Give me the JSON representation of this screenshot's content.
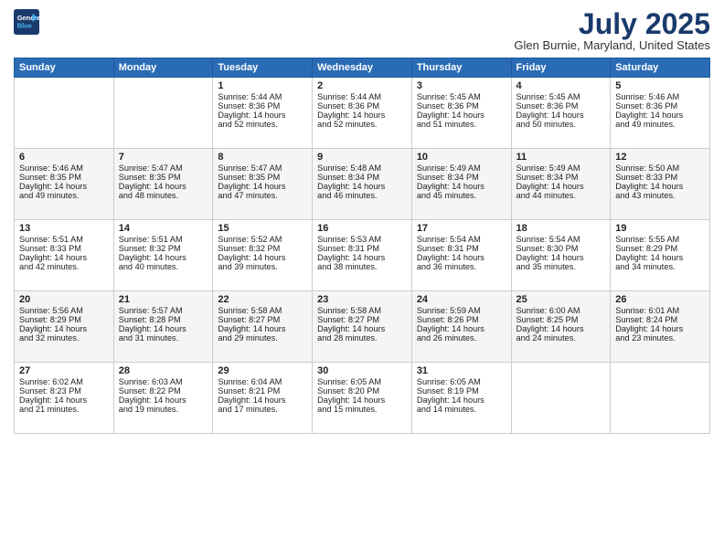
{
  "logo": {
    "line1": "General",
    "line2": "Blue"
  },
  "title": "July 2025",
  "location": "Glen Burnie, Maryland, United States",
  "days_of_week": [
    "Sunday",
    "Monday",
    "Tuesday",
    "Wednesday",
    "Thursday",
    "Friday",
    "Saturday"
  ],
  "weeks": [
    [
      {
        "day": "",
        "text": ""
      },
      {
        "day": "",
        "text": ""
      },
      {
        "day": "1",
        "text": "Sunrise: 5:44 AM\nSunset: 8:36 PM\nDaylight: 14 hours\nand 52 minutes."
      },
      {
        "day": "2",
        "text": "Sunrise: 5:44 AM\nSunset: 8:36 PM\nDaylight: 14 hours\nand 52 minutes."
      },
      {
        "day": "3",
        "text": "Sunrise: 5:45 AM\nSunset: 8:36 PM\nDaylight: 14 hours\nand 51 minutes."
      },
      {
        "day": "4",
        "text": "Sunrise: 5:45 AM\nSunset: 8:36 PM\nDaylight: 14 hours\nand 50 minutes."
      },
      {
        "day": "5",
        "text": "Sunrise: 5:46 AM\nSunset: 8:36 PM\nDaylight: 14 hours\nand 49 minutes."
      }
    ],
    [
      {
        "day": "6",
        "text": "Sunrise: 5:46 AM\nSunset: 8:35 PM\nDaylight: 14 hours\nand 49 minutes."
      },
      {
        "day": "7",
        "text": "Sunrise: 5:47 AM\nSunset: 8:35 PM\nDaylight: 14 hours\nand 48 minutes."
      },
      {
        "day": "8",
        "text": "Sunrise: 5:47 AM\nSunset: 8:35 PM\nDaylight: 14 hours\nand 47 minutes."
      },
      {
        "day": "9",
        "text": "Sunrise: 5:48 AM\nSunset: 8:34 PM\nDaylight: 14 hours\nand 46 minutes."
      },
      {
        "day": "10",
        "text": "Sunrise: 5:49 AM\nSunset: 8:34 PM\nDaylight: 14 hours\nand 45 minutes."
      },
      {
        "day": "11",
        "text": "Sunrise: 5:49 AM\nSunset: 8:34 PM\nDaylight: 14 hours\nand 44 minutes."
      },
      {
        "day": "12",
        "text": "Sunrise: 5:50 AM\nSunset: 8:33 PM\nDaylight: 14 hours\nand 43 minutes."
      }
    ],
    [
      {
        "day": "13",
        "text": "Sunrise: 5:51 AM\nSunset: 8:33 PM\nDaylight: 14 hours\nand 42 minutes."
      },
      {
        "day": "14",
        "text": "Sunrise: 5:51 AM\nSunset: 8:32 PM\nDaylight: 14 hours\nand 40 minutes."
      },
      {
        "day": "15",
        "text": "Sunrise: 5:52 AM\nSunset: 8:32 PM\nDaylight: 14 hours\nand 39 minutes."
      },
      {
        "day": "16",
        "text": "Sunrise: 5:53 AM\nSunset: 8:31 PM\nDaylight: 14 hours\nand 38 minutes."
      },
      {
        "day": "17",
        "text": "Sunrise: 5:54 AM\nSunset: 8:31 PM\nDaylight: 14 hours\nand 36 minutes."
      },
      {
        "day": "18",
        "text": "Sunrise: 5:54 AM\nSunset: 8:30 PM\nDaylight: 14 hours\nand 35 minutes."
      },
      {
        "day": "19",
        "text": "Sunrise: 5:55 AM\nSunset: 8:29 PM\nDaylight: 14 hours\nand 34 minutes."
      }
    ],
    [
      {
        "day": "20",
        "text": "Sunrise: 5:56 AM\nSunset: 8:29 PM\nDaylight: 14 hours\nand 32 minutes."
      },
      {
        "day": "21",
        "text": "Sunrise: 5:57 AM\nSunset: 8:28 PM\nDaylight: 14 hours\nand 31 minutes."
      },
      {
        "day": "22",
        "text": "Sunrise: 5:58 AM\nSunset: 8:27 PM\nDaylight: 14 hours\nand 29 minutes."
      },
      {
        "day": "23",
        "text": "Sunrise: 5:58 AM\nSunset: 8:27 PM\nDaylight: 14 hours\nand 28 minutes."
      },
      {
        "day": "24",
        "text": "Sunrise: 5:59 AM\nSunset: 8:26 PM\nDaylight: 14 hours\nand 26 minutes."
      },
      {
        "day": "25",
        "text": "Sunrise: 6:00 AM\nSunset: 8:25 PM\nDaylight: 14 hours\nand 24 minutes."
      },
      {
        "day": "26",
        "text": "Sunrise: 6:01 AM\nSunset: 8:24 PM\nDaylight: 14 hours\nand 23 minutes."
      }
    ],
    [
      {
        "day": "27",
        "text": "Sunrise: 6:02 AM\nSunset: 8:23 PM\nDaylight: 14 hours\nand 21 minutes."
      },
      {
        "day": "28",
        "text": "Sunrise: 6:03 AM\nSunset: 8:22 PM\nDaylight: 14 hours\nand 19 minutes."
      },
      {
        "day": "29",
        "text": "Sunrise: 6:04 AM\nSunset: 8:21 PM\nDaylight: 14 hours\nand 17 minutes."
      },
      {
        "day": "30",
        "text": "Sunrise: 6:05 AM\nSunset: 8:20 PM\nDaylight: 14 hours\nand 15 minutes."
      },
      {
        "day": "31",
        "text": "Sunrise: 6:05 AM\nSunset: 8:19 PM\nDaylight: 14 hours\nand 14 minutes."
      },
      {
        "day": "",
        "text": ""
      },
      {
        "day": "",
        "text": ""
      }
    ]
  ]
}
